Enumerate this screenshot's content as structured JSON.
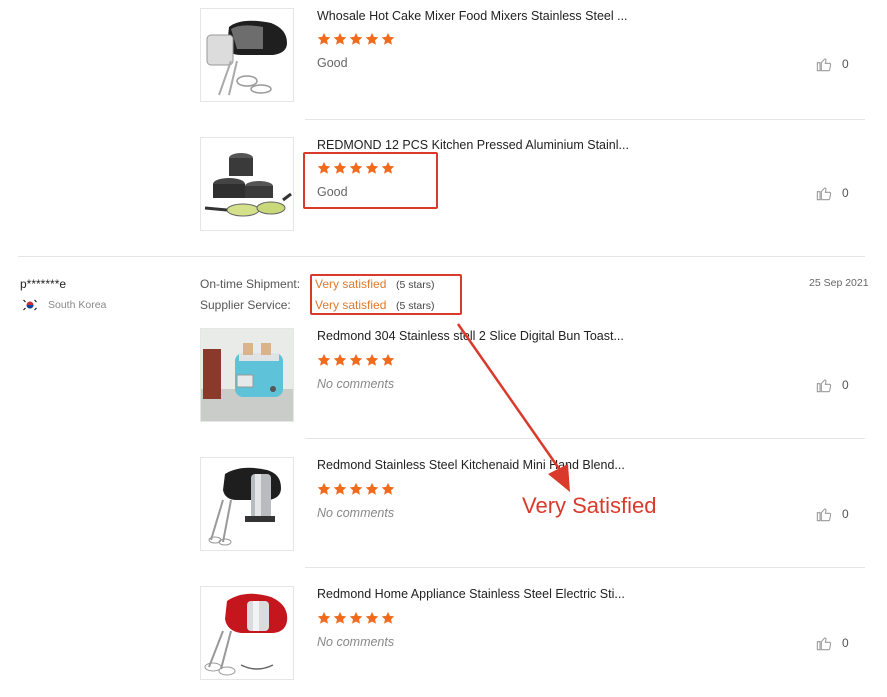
{
  "products": [
    {
      "title": "Whosale Hot Cake Mixer Food Mixers Stainless Steel ...",
      "comment": "Good",
      "likes": "0",
      "rating": 5,
      "image": "hand-mixer-black"
    },
    {
      "title": "REDMOND 12 PCS Kitchen Pressed Aluminium Stainl...",
      "comment": "Good",
      "likes": "0",
      "rating": 5,
      "image": "cookware-set"
    },
    {
      "title": "Redmond 304 Stainless stell 2 Slice Digital Bun Toast...",
      "comment": "No comments",
      "likes": "0",
      "rating": 5,
      "image": "toaster-blue"
    },
    {
      "title": "Redmond Stainless Steel Kitchenaid Mini Hand Blend...",
      "comment": "No comments",
      "likes": "0",
      "rating": 5,
      "image": "hand-mixer-steel"
    },
    {
      "title": "Redmond Home Appliance Stainless Steel Electric Sti...",
      "comment": "No comments",
      "likes": "0",
      "rating": 5,
      "image": "hand-mixer-red"
    }
  ],
  "review": {
    "user": "p*******e",
    "country": "South Korea",
    "date": "25 Sep 2021",
    "shipment_label": "On-time Shipment:",
    "shipment_value": "Very satisfied",
    "shipment_stars": "(5 stars)",
    "service_label": "Supplier Service:",
    "service_value": "Very satisfied",
    "service_stars": "(5 stars)"
  },
  "annotation": {
    "text": "Very Satisfied",
    "color": "#d93a2b"
  },
  "colors": {
    "star": "#f26b1d",
    "accent": "#e0792a",
    "highlight": "#d93a2b"
  }
}
